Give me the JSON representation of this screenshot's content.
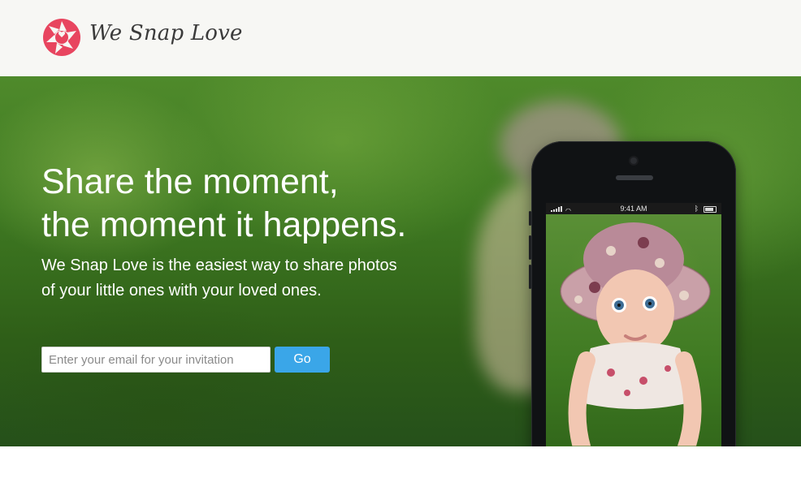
{
  "brand": {
    "name": "We Snap Love",
    "logo_color": "#e8455f"
  },
  "hero": {
    "headline_line1": "Share the moment,",
    "headline_line2": "the moment it happens.",
    "subheadline_line1": "We Snap Love is the easiest way to share photos",
    "subheadline_line2": "of your little ones with your loved ones."
  },
  "signup": {
    "email_placeholder": "Enter your email for your invitation",
    "email_value": "",
    "button_label": "Go",
    "button_color": "#3aa6e8"
  },
  "phone": {
    "status_time": "9:41 AM"
  }
}
